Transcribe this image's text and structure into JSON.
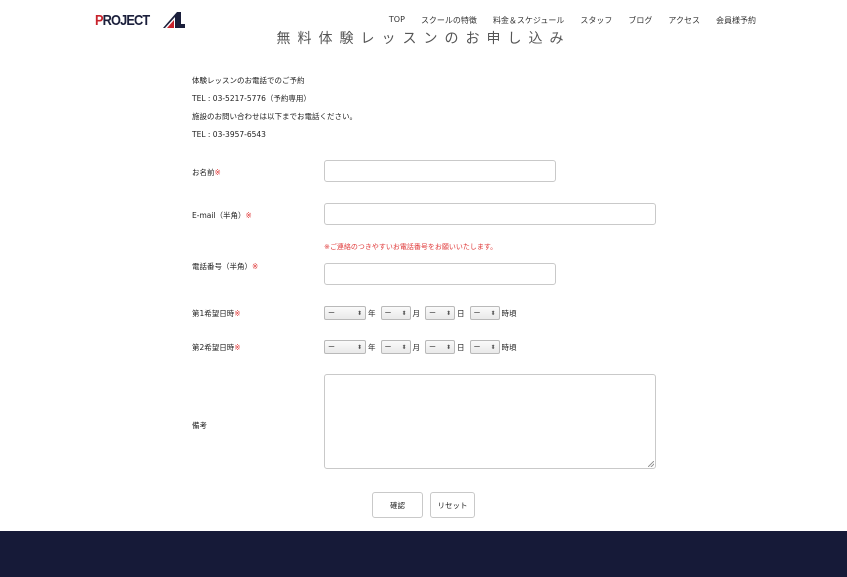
{
  "header": {
    "logo_p": "P",
    "logo_rest": "ROJECT",
    "nav": [
      "TOP",
      "スクールの特徴",
      "料金＆スケジュール",
      "スタッフ",
      "ブログ",
      "アクセス",
      "会員様予約"
    ]
  },
  "page_title": "無料体験レッスンのお申し込み",
  "info": [
    "体験レッスンのお電話でのご予約",
    "TEL : 03-5217-5776（予約専用）",
    "施設のお問い合わせは以下までお電話ください。",
    "TEL : 03-3957-6543"
  ],
  "form": {
    "required_mark": "※",
    "name_label": "お名前",
    "email_label": "E-mail（半角）",
    "phone_note": "※ご連絡のつきやすいお電話番号をお願いいたします。",
    "phone_label": "電話番号（半角）",
    "first_choice_label": "第1希望日時",
    "second_choice_label": "第2希望日時",
    "remarks_label": "備考",
    "select_value": "ー",
    "unit_year": "年",
    "unit_month": "月",
    "unit_day": "日",
    "unit_hour": "時頃",
    "confirm_button": "確認",
    "reset_button": "リセット"
  },
  "colors": {
    "footer": "#161a38",
    "required": "#e03a3a",
    "logo_red": "#c8232c",
    "logo_navy": "#1b1f3b"
  }
}
